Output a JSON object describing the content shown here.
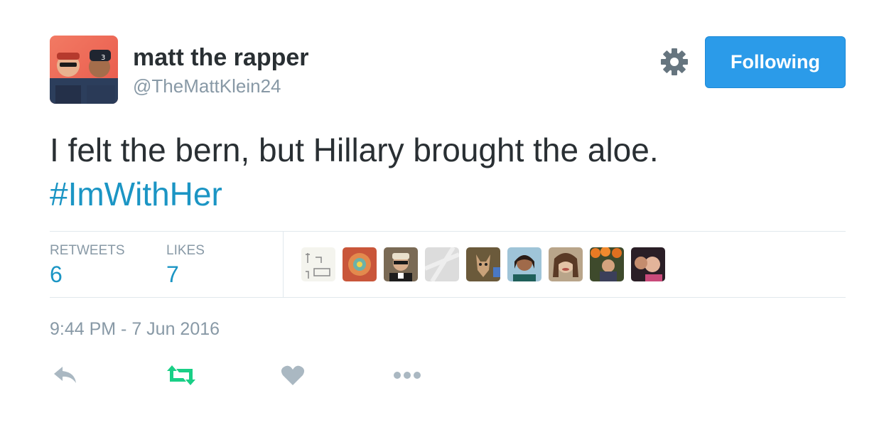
{
  "user": {
    "display_name": "matt the rapper",
    "handle": "@TheMattKlein24"
  },
  "follow_button": {
    "label": "Following"
  },
  "tweet": {
    "text": "I felt the bern, but Hillary brought the aloe.",
    "hashtag": "#ImWithHer"
  },
  "stats": {
    "retweets_label": "RETWEETS",
    "retweets": "6",
    "likes_label": "LIKES",
    "likes": "7"
  },
  "timestamp": "9:44 PM - 7 Jun 2016",
  "colors": {
    "accent": "#1b95c4",
    "follow_button": "#2b9be9",
    "retweet_active": "#19cf86",
    "muted": "#8899a6"
  },
  "icons": [
    "gear-icon",
    "reply-icon",
    "retweet-icon",
    "like-icon",
    "more-icon"
  ]
}
